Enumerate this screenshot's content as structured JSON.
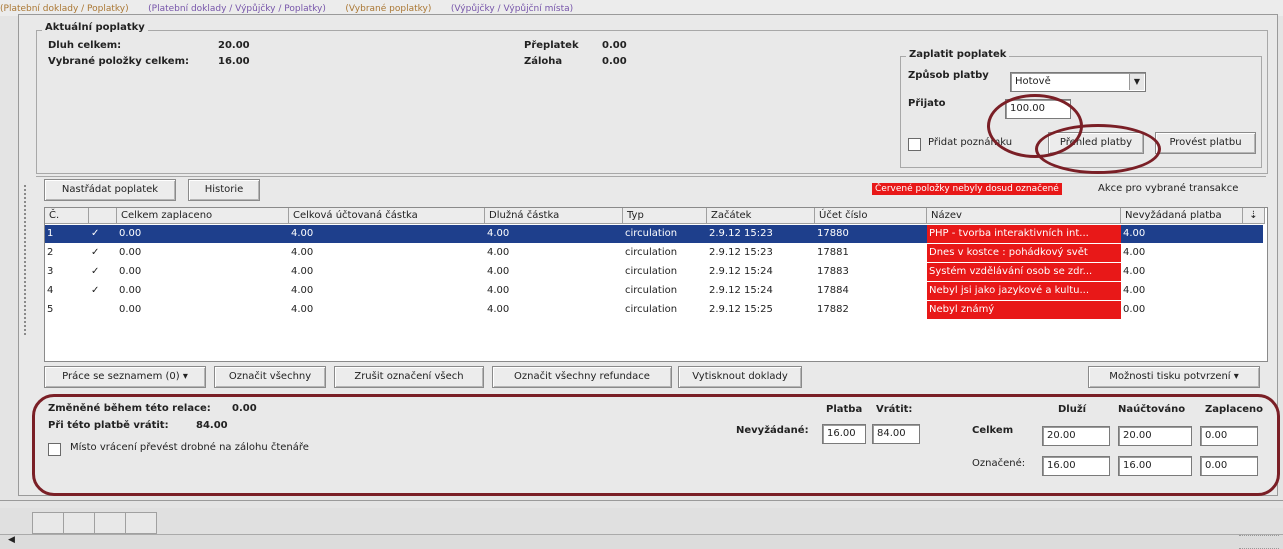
{
  "top_strip": [
    "(Platební doklady / Poplatky)",
    "(Platební doklady / Výpůjčky / Poplatky)",
    "(Vybrané poplatky)",
    "(Výpůjčky / Výpůjční místa)"
  ],
  "current_fees": {
    "legend": "Aktuální poplatky",
    "debt_total_label": "Dluh celkem:",
    "debt_total_value": "20.00",
    "selected_total_label": "Vybrané položky celkem:",
    "selected_total_value": "16.00",
    "overpayment_label": "Přeplatek",
    "overpayment_value": "0.00",
    "deposit_label": "Záloha",
    "deposit_value": "0.00"
  },
  "pay_fee": {
    "legend": "Zaplatit poplatek",
    "method_label": "Způsob platby",
    "method_value": "Hotově",
    "received_label": "Přijato",
    "received_value": "100.00",
    "attach_receipt_label": "Přidat poznámku",
    "preview_button": "Přehled platby",
    "pay_button": "Provést platbu"
  },
  "toolbar": {
    "new_fee_button": "Nastřádat poplatek",
    "history_button": "Historie",
    "red_notice": "Červené položky nebyly dosud označené",
    "actions_label": "Akce pro vybrané transakce"
  },
  "grid": {
    "columns": [
      "Č.",
      "",
      "Celkem zaplaceno",
      "Celková účtovaná částka",
      "Dlužná částka",
      "Typ",
      "Začátek",
      "Účet číslo",
      "Název",
      "Nevyžádaná platba"
    ],
    "rows": [
      {
        "num": "1",
        "check": "✓",
        "paid": "0.00",
        "charged": "4.00",
        "owed": "4.00",
        "type": "circulation",
        "start": "2.9.12 15:23",
        "account": "17880",
        "title": "PHP - tvorba interaktivních int...",
        "unclaimed": "4.00",
        "selected": true
      },
      {
        "num": "2",
        "check": "✓",
        "paid": "0.00",
        "charged": "4.00",
        "owed": "4.00",
        "type": "circulation",
        "start": "2.9.12 15:23",
        "account": "17881",
        "title": "Dnes v kostce : pohádkový svět",
        "unclaimed": "4.00",
        "selected": false
      },
      {
        "num": "3",
        "check": "✓",
        "paid": "0.00",
        "charged": "4.00",
        "owed": "4.00",
        "type": "circulation",
        "start": "2.9.12 15:24",
        "account": "17883",
        "title": "Systém vzdělávání osob se zdr...",
        "unclaimed": "4.00",
        "selected": false
      },
      {
        "num": "4",
        "check": "✓",
        "paid": "0.00",
        "charged": "4.00",
        "owed": "4.00",
        "type": "circulation",
        "start": "2.9.12 15:24",
        "account": "17884",
        "title": "Nebyl jsi jako jazykové a kultu...",
        "unclaimed": "4.00",
        "selected": false
      },
      {
        "num": "5",
        "check": "",
        "paid": "0.00",
        "charged": "4.00",
        "owed": "4.00",
        "type": "circulation",
        "start": "2.9.12 15:25",
        "account": "17882",
        "title": "Nebyl známý",
        "unclaimed": "0.00",
        "selected": false
      }
    ]
  },
  "bottom_buttons": {
    "list_work": "Práce se seznamem (0) ▾",
    "mark_all": "Označit všechny",
    "unmark_all": "Zrušit označení všech",
    "mark_all_refunds": "Označit všechny refundace",
    "print_docs": "Vytisknout doklady",
    "confirm_options": "Možnosti tisku potvrzení ▾"
  },
  "summary": {
    "changed_label": "Změněné během této relace:",
    "changed_value": "0.00",
    "payment_label": "Při této platbě vrátit:",
    "payment_value": "84.00",
    "unclaimed_label": "Nevyžádané:",
    "deposit_checkbox": "Místo vrácení převést drobné na zálohu čtenáře",
    "payment_col": "Platba",
    "payment_col_value": "16.00",
    "return_col": "Vrátit:",
    "return_col_value": "84.00",
    "total_row": "Celkem",
    "marked_row": "Označené:",
    "debt_col": "Dluží",
    "charged_col": "Naúčtováno",
    "paid_col": "Zaplaceno",
    "total_debt": "20.00",
    "total_charged": "20.00",
    "total_paid": "0.00",
    "marked_debt": "16.00",
    "marked_charged": "16.00",
    "marked_paid": "0.00"
  },
  "colors": {
    "selection": "#1e3f8c",
    "red_cell": "#e81818",
    "annotation": "#7a1f26"
  }
}
